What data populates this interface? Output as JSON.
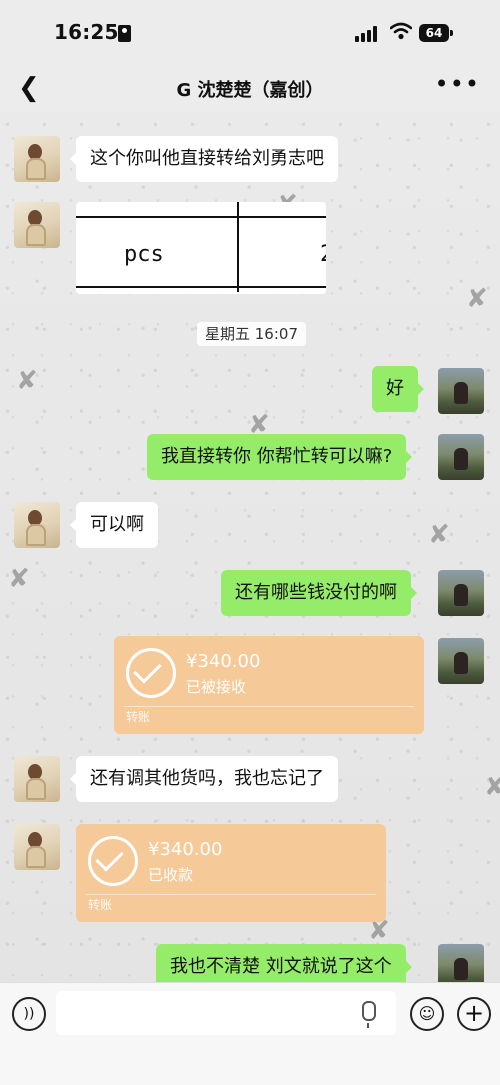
{
  "status_bar": {
    "time": "16:25",
    "battery": "64"
  },
  "header": {
    "title": "G 沈楚楚（嘉创）",
    "back_icon": "chevron-left-icon",
    "more_icon": "ellipsis-icon"
  },
  "chat": {
    "timestamp": "星期五 16:07",
    "messages": [
      {
        "side": "left",
        "type": "text",
        "text": "这个你叫他直接转给刘勇志吧"
      },
      {
        "side": "left",
        "type": "image",
        "cells": [
          "pcs",
          "2"
        ]
      },
      {
        "side": "right",
        "type": "text",
        "text": "好"
      },
      {
        "side": "right",
        "type": "text",
        "text": "我直接转你 你帮忙转可以嘛?"
      },
      {
        "side": "left",
        "type": "text",
        "text": "可以啊"
      },
      {
        "side": "right",
        "type": "text",
        "text": "还有哪些钱没付的啊"
      },
      {
        "side": "right",
        "type": "transfer",
        "amount": "¥340.00",
        "status": "已被接收",
        "label": "转账"
      },
      {
        "side": "left",
        "type": "text",
        "text": "还有调其他货吗，我也忘记了"
      },
      {
        "side": "left",
        "type": "transfer",
        "amount": "¥340.00",
        "status": "已收款",
        "label": "转账"
      },
      {
        "side": "right",
        "type": "text",
        "text": "我也不清楚 刘文就说了这个"
      }
    ]
  },
  "input_bar": {
    "placeholder": "",
    "voice_icon": "voice-icon",
    "emoji_icon": "emoji-icon",
    "plus_icon": "plus-icon"
  },
  "colors": {
    "outgoing_bubble": "#95ec69",
    "incoming_bubble": "#ffffff",
    "transfer_card": "#f5c998"
  }
}
